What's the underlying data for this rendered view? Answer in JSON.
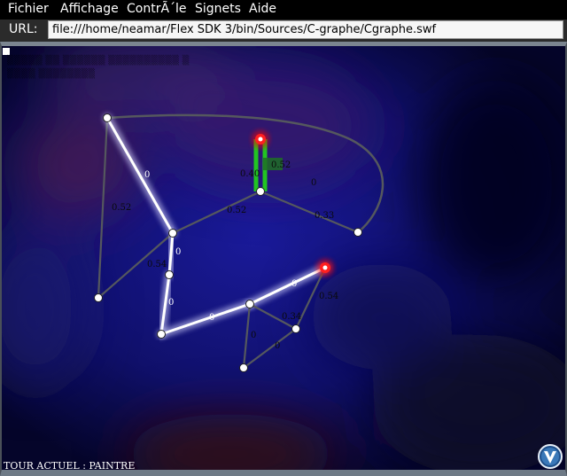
{
  "menu": [
    "Fichier",
    "Affichage",
    "ContrÃ´le",
    "Signets",
    "Aide"
  ],
  "url": {
    "label": "URL:",
    "value": "file:///home/neamar/Flex SDK 3/bin/Sources/C-graphe/Cgraphe.swf"
  },
  "game": {
    "status": "TOUR ACTUEL : PAINTRE",
    "edge_labels": {
      "e_a": "0.52",
      "e_b": "0",
      "e_c": "0.52",
      "e_d": "0.33",
      "e_e": "0.52",
      "e_f": "0.54",
      "e_g": "0.40",
      "e_h": "0",
      "e_i": "0",
      "e_j": "0",
      "e_k": "0",
      "e_l": "0.54",
      "e_m": "0.34",
      "e_n": "0",
      "e_o": "0",
      "e_p": "0"
    }
  },
  "colors": {
    "background": "#101060",
    "highlight_edge": "#ffffff",
    "active_edge": "#22c422",
    "edge": "#55585e",
    "active_node": "#ff2020",
    "node": "#ffffff"
  },
  "icons": {
    "logo": "circle-v-logo-icon"
  }
}
